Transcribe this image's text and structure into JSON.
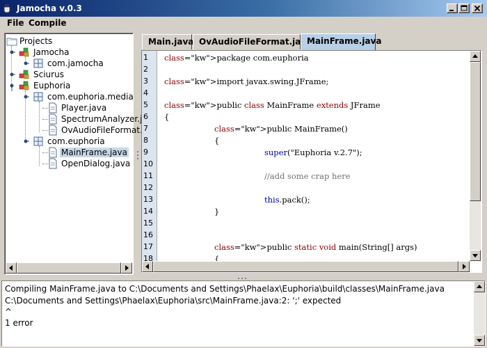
{
  "window": {
    "title": "Jamocha v.0.3"
  },
  "menu": [
    "File",
    "Compile"
  ],
  "tree": {
    "root": "Projects",
    "nodes": [
      "Jamocha",
      "com.jamocha",
      "Sciurus",
      "Euphoria",
      "com.euphoria.media",
      "Player.java",
      "SpectrumAnalyzer.java",
      "OvAudioFileFormat.java",
      "com.euphoria",
      "MainFrame.java",
      "OpenDialog.java"
    ],
    "selected": "MainFrame.java"
  },
  "tabs": [
    {
      "label": "Main.java",
      "active": false
    },
    {
      "label": "OvAudioFileFormat.java",
      "active": false
    },
    {
      "label": "MainFrame.java",
      "active": true
    }
  ],
  "editor": {
    "line_numbers": [
      "1",
      "2",
      "3",
      "4",
      "5",
      "6",
      "7",
      "8",
      "9",
      "10",
      "11",
      "12",
      "13",
      "14",
      "15",
      "16",
      "17",
      "18"
    ],
    "lines": [
      "package com.euphoria",
      "",
      "import javax.swing.JFrame;",
      "",
      "public class MainFrame extends JFrame",
      "{",
      "public MainFrame()",
      "{",
      "super(\"Euphoria v.2.7\");",
      "",
      "//add some crap here",
      "",
      "this.pack();",
      "}",
      "",
      "",
      "public static void main(String[] args)",
      "{"
    ]
  },
  "output": {
    "lines": [
      "Compiling MainFrame.java to C:\\Documents and Settings\\Phaelax\\Euphoria\\build\\classes\\MainFrame.java",
      "C:\\Documents and Settings\\Phaelax\\Euphoria\\src\\MainFrame.java:2: ';' expected",
      "^",
      "1 error"
    ]
  },
  "colors": {
    "title_start": "#0a246a",
    "title_end": "#a6caf0",
    "keyword": "#8b0000",
    "gutter": "#dce4ee",
    "active_tab": "#b8cfe5",
    "selection": "#c8d8e8"
  }
}
